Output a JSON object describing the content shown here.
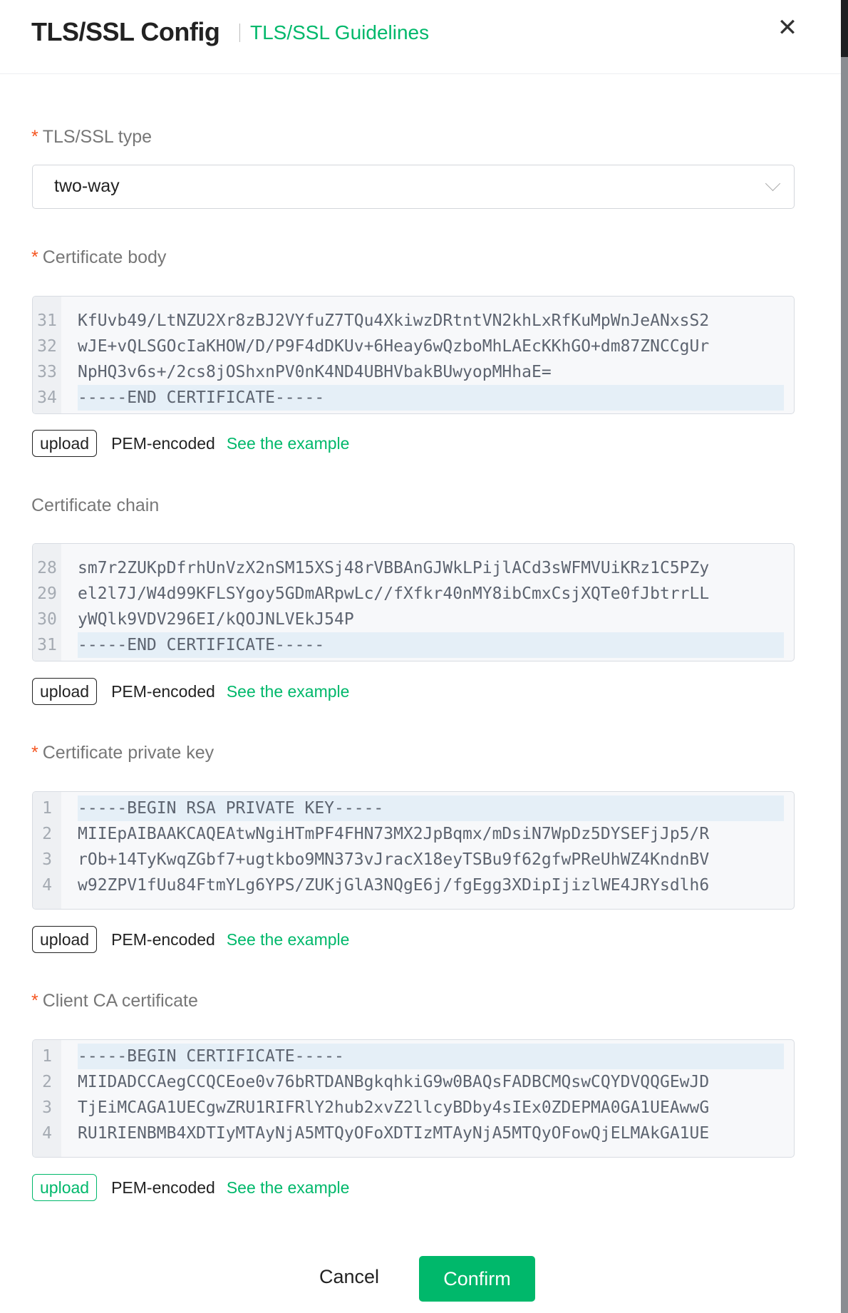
{
  "header": {
    "title": "TLS/SSL Config",
    "guidelines_link": "TLS/SSL Guidelines",
    "close_icon": "close-icon"
  },
  "colors": {
    "accent": "#00b86b",
    "required": "#f5541f"
  },
  "fields": {
    "tls_type": {
      "label": "TLS/SSL type",
      "required": true,
      "value": "two-way"
    },
    "cert_body": {
      "label": "Certificate body",
      "required": true,
      "lines": [
        {
          "n": "31",
          "text": "KfUvb49/LtNZU2Xr8zBJ2VYfuZ7TQu4XkiwzDRtntVN2khLxRfKuMpWnJeANxsS2"
        },
        {
          "n": "32",
          "text": "wJE+vQLSGOcIaKHOW/D/P9F4dDKUv+6Heay6wQzboMhLAEcKKhGO+dm87ZNCCgUr"
        },
        {
          "n": "33",
          "text": "NpHQ3v6s+/2cs8jOShxnPV0nK4ND4UBHVbakBUwyopMHhaE="
        },
        {
          "n": "34",
          "text": "-----END CERTIFICATE-----"
        }
      ]
    },
    "cert_chain": {
      "label": "Certificate chain",
      "required": false,
      "lines": [
        {
          "n": "28",
          "text": "sm7r2ZUKpDfrhUnVzX2nSM15XSj48rVBBAnGJWkLPijlACd3sWFMVUiKRz1C5PZy"
        },
        {
          "n": "29",
          "text": "el2l7J/W4d99KFLSYgoy5GDmARpwLc//fXfkr40nMY8ibCmxCsjXQTe0fJbtrrLL"
        },
        {
          "n": "30",
          "text": "yWQlk9VDV296EI/kQOJNLVEkJ54P"
        },
        {
          "n": "31",
          "text": "-----END CERTIFICATE-----"
        }
      ]
    },
    "private_key": {
      "label": "Certificate private key",
      "required": true,
      "lines": [
        {
          "n": "1",
          "text": "-----BEGIN RSA PRIVATE KEY-----"
        },
        {
          "n": "2",
          "text": "MIIEpAIBAAKCAQEAtwNgiHTmPF4FHN73MX2JpBqmx/mDsiN7WpDz5DYSEFjJp5/R"
        },
        {
          "n": "3",
          "text": "rOb+14TyKwqZGbf7+ugtkbo9MN373vJracX18eyTSBu9f62gfwPReUhWZ4KndnBV"
        },
        {
          "n": "4",
          "text": "w92ZPV1fUu84FtmYLg6YPS/ZUKjGlA3NQgE6j/fgEgg3XDipIjizlWE4JRYsdlh6"
        }
      ]
    },
    "client_ca": {
      "label": "Client CA certificate",
      "required": true,
      "lines": [
        {
          "n": "1",
          "text": "-----BEGIN CERTIFICATE-----"
        },
        {
          "n": "2",
          "text": "MIIDADCCAegCCQCEoe0v76bRTDANBgkqhkiG9w0BAQsFADBCMQswCQYDVQQGEwJD"
        },
        {
          "n": "3",
          "text": "TjEiMCAGA1UECgwZRU1RIFRlY2hub2xvZ2llcyBDby4sIEx0ZDEPMA0GA1UEAwwG"
        },
        {
          "n": "4",
          "text": "RU1RIENBMB4XDTIyMTAyNjA5MTQyOFoXDTIzMTAyNjA5MTQyOFowQjELMAkGA1UE"
        }
      ]
    }
  },
  "upload_row": {
    "upload_label": "upload",
    "format_label": "PEM-encoded",
    "example_link": "See the example"
  },
  "footer": {
    "cancel_label": "Cancel",
    "confirm_label": "Confirm"
  }
}
